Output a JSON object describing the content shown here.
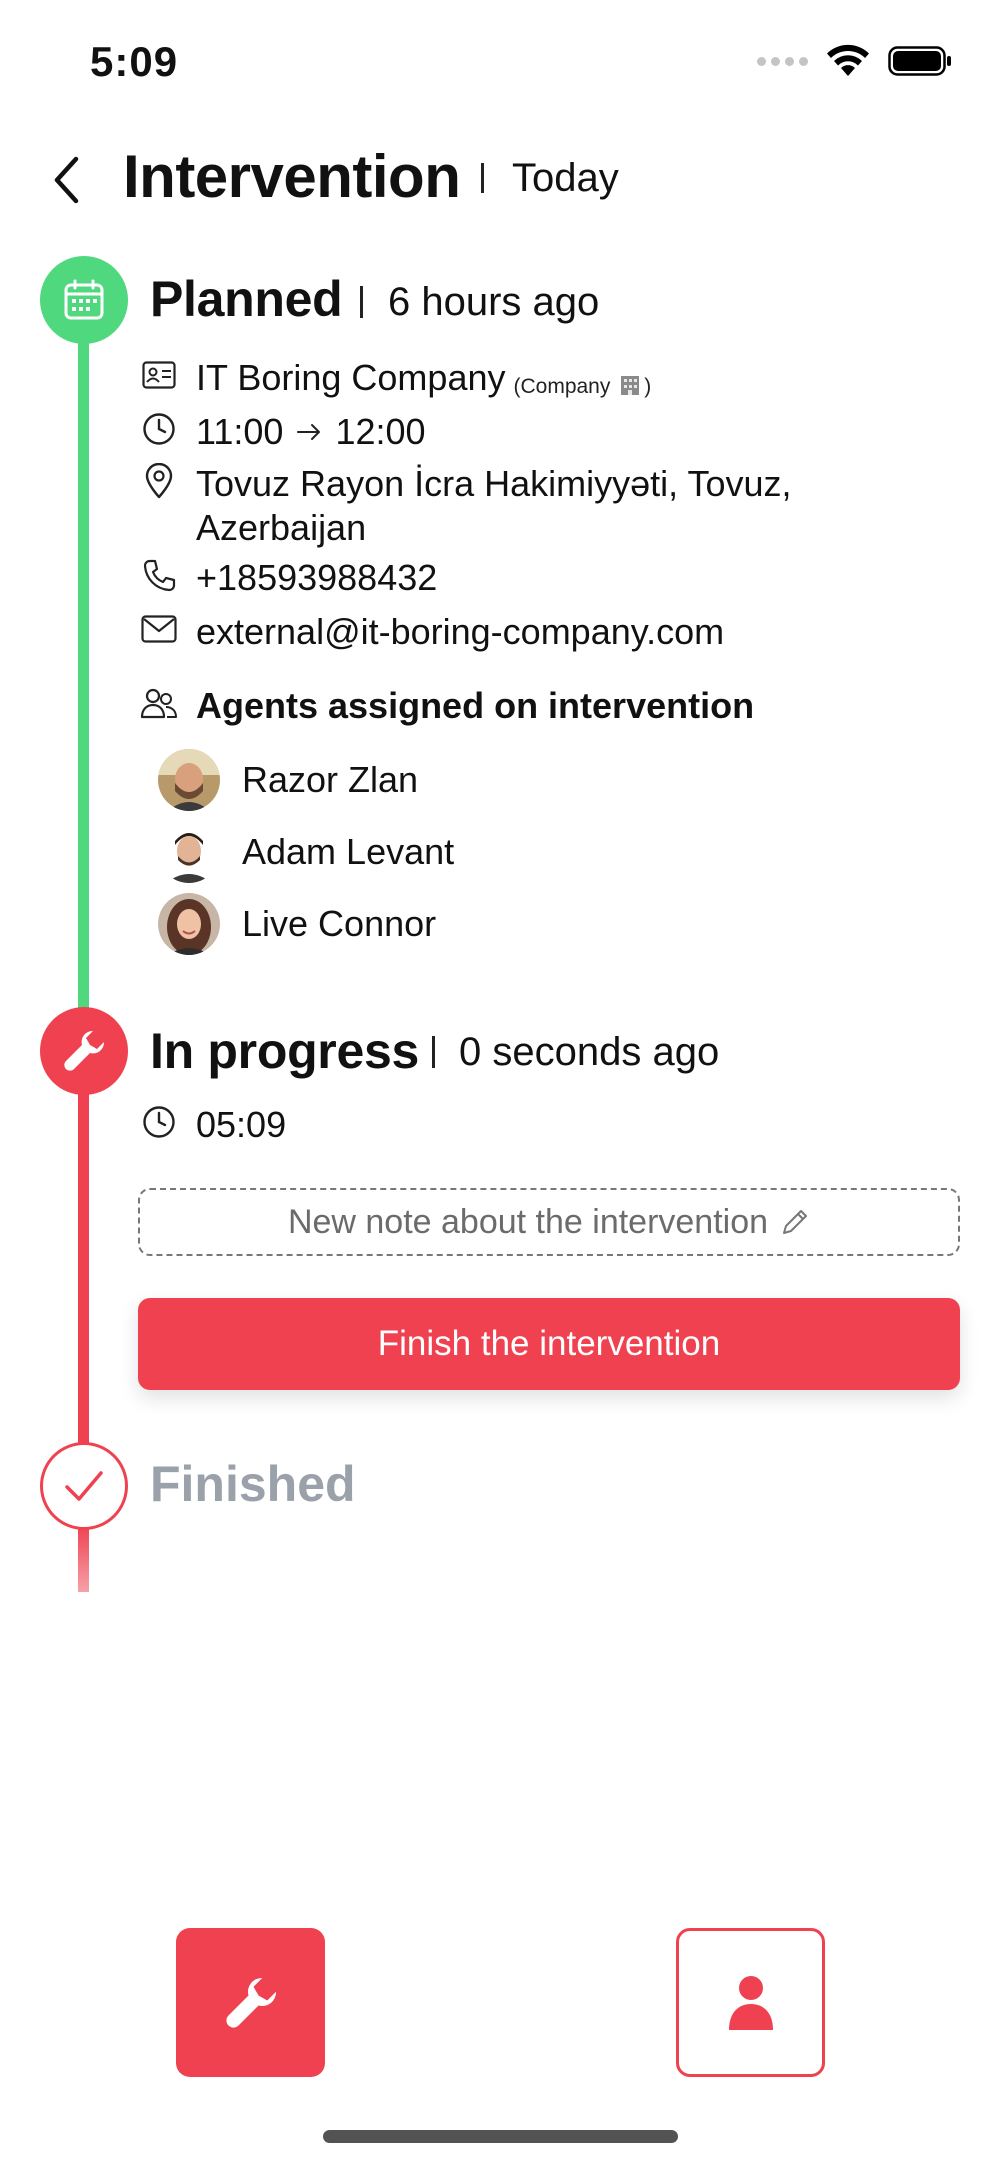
{
  "status_bar": {
    "time": "5:09"
  },
  "header": {
    "title": "Intervention",
    "subtitle": "Today"
  },
  "steps": {
    "planned": {
      "title": "Planned",
      "time_ago": "6 hours ago",
      "company": "IT Boring Company",
      "company_tag": "(Company",
      "company_tag_close": ")",
      "schedule_start": "11:00",
      "schedule_end": "12:00",
      "address_line1": "Tovuz Rayon İcra Hakimiyyəti, Tovuz,",
      "address_line2": "Azerbaijan",
      "phone": "+18593988432",
      "email": "external@it-boring-company.com",
      "agents_heading": "Agents assigned on intervention",
      "agents": [
        {
          "name": "Razor Zlan"
        },
        {
          "name": "Adam Levant"
        },
        {
          "name": "Live Connor"
        }
      ]
    },
    "in_progress": {
      "title": "In progress",
      "time_ago": "0 seconds ago",
      "start_time": "05:09",
      "note_placeholder": "New note about the intervention",
      "finish_button": "Finish the intervention"
    },
    "finished": {
      "title": "Finished"
    }
  },
  "colors": {
    "planned": "#4fd87e",
    "accent": "#ef4150",
    "muted": "#9aa1ab"
  },
  "icons": {
    "planned": "calendar-icon",
    "in_progress": "wrench-icon",
    "finished": "check-icon",
    "nav_left": "wrench-icon",
    "nav_right": "person-icon"
  }
}
